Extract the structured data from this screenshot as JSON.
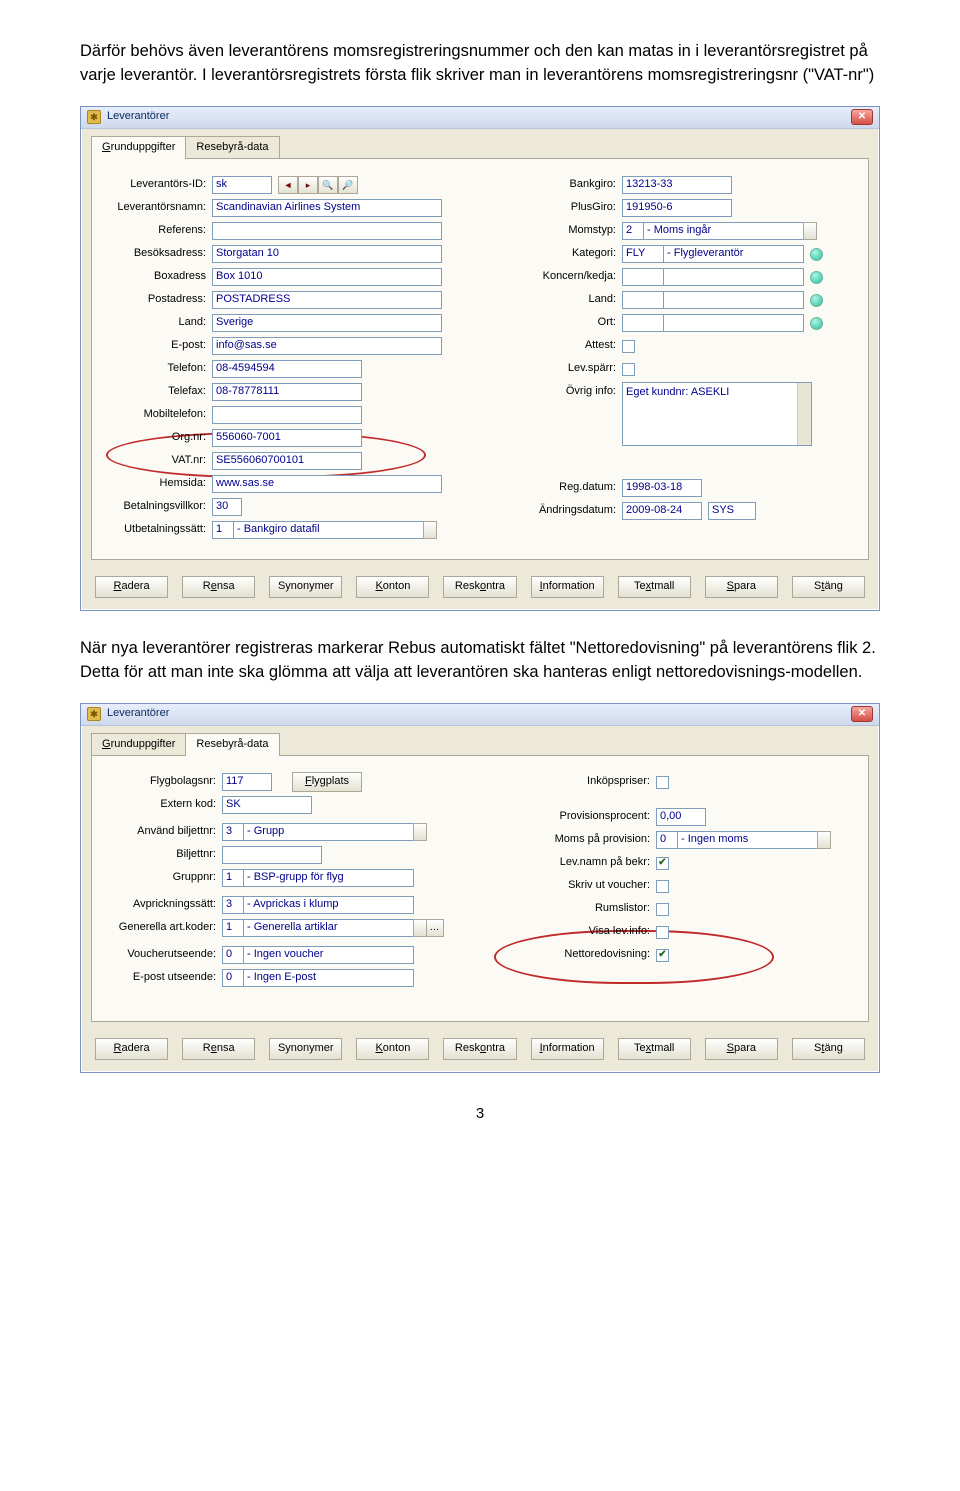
{
  "paragraph1": "Därför behövs även leverantörens momsregistreringsnummer och den kan matas in i leverantörsregistret på varje leverantör. I leverantörsregistrets första flik skriver man in leverantörens momsregistreringsnr (\"VAT-nr\")",
  "paragraph2": "När nya leverantörer registreras markerar Rebus automatiskt fältet \"Nettoredovisning\" på leverantörens flik 2. Detta för att man inte ska glömma att välja att leverantören ska hanteras enligt nettoredovisnings-modellen.",
  "page_num": "3",
  "win1": {
    "title": "Leverantörer",
    "tabs": {
      "a": "Grunduppgifter",
      "b": "Resebyrå-data"
    },
    "left_labels": {
      "lev_id": "Leverantörs-ID:",
      "lev_namn": "Leverantörsnamn:",
      "ref": "Referens:",
      "besok": "Besöksadress:",
      "box": "Boxadress",
      "post": "Postadress:",
      "land": "Land:",
      "epost": "E-post:",
      "tel": "Telefon:",
      "fax": "Telefax:",
      "mobil": "Mobiltelefon:",
      "org": "Org.nr:",
      "vat": "VAT.nr:",
      "hem": "Hemsida:",
      "betv": "Betalningsvillkor:",
      "utb": "Utbetalningssätt:"
    },
    "left_values": {
      "lev_id": "sk",
      "lev_namn": "Scandinavian Airlines System",
      "ref": "",
      "besok": "Storgatan 10",
      "box": "Box 1010",
      "post": "POSTADRESS",
      "land": "Sverige",
      "epost": "info@sas.se",
      "tel": "08-4594594",
      "fax": "08-78778111",
      "mobil": "",
      "org": "556060-7001",
      "vat": "SE556060700101",
      "hem": "www.sas.se",
      "betv": "30",
      "utb_code": "1",
      "utb_text": "- Bankgiro datafil"
    },
    "right_labels": {
      "bank": "Bankgiro:",
      "plus": "PlusGiro:",
      "momstyp": "Momstyp:",
      "kategori": "Kategori:",
      "koncern": "Koncern/kedja:",
      "land": "Land:",
      "ort": "Ort:",
      "attest": "Attest:",
      "spärr": "Lev.spärr:",
      "info": "Övrig info:",
      "reg": "Reg.datum:",
      "andr": "Ändringsdatum:"
    },
    "right_values": {
      "bank": "13213-33",
      "plus": "191950-6",
      "momstyp_code": "2",
      "momstyp_text": "- Moms ingår",
      "kat_code": "FLY",
      "kat_text": "- Flygleverantör",
      "koncern": "",
      "land": "",
      "ort": "",
      "info": "Eget kundnr: ASEKLI",
      "reg": "1998-03-18",
      "andr": "2009-08-24",
      "andr_by": "SYS"
    },
    "buttons": {
      "radera": "Radera",
      "rensa": "Rensa",
      "synonymer": "Synonymer",
      "konton": "Konton",
      "reskontra": "Reskontra",
      "information": "Information",
      "textmall": "Textmall",
      "spara": "Spara",
      "stang": "Stäng"
    }
  },
  "win2": {
    "title": "Leverantörer",
    "tabs": {
      "a": "Grunduppgifter",
      "b": "Resebyrå-data"
    },
    "left_labels": {
      "flyg": "Flygbolagsnr:",
      "flygplats": "Flygplats",
      "ext": "Extern kod:",
      "anvbilj": "Använd biljettnr:",
      "bilj": "Biljettnr:",
      "grupp": "Gruppnr:",
      "avp": "Avprickningssätt:",
      "genart": "Generella art.koder:",
      "vou": "Voucherutseende:",
      "epostu": "E-post utseende:"
    },
    "left_values": {
      "flyg": "117",
      "ext": "SK",
      "anvbilj_code": "3",
      "anvbilj_text": "- Grupp",
      "bilj": "",
      "grupp_code": "1",
      "grupp_text": "- BSP-grupp för flyg",
      "avp_code": "3",
      "avp_text": "- Avprickas i klump",
      "genart_code": "1",
      "genart_text": "- Generella artiklar",
      "vou_code": "0",
      "vou_text": "- Ingen voucher",
      "epostu_code": "0",
      "epostu_text": "- Ingen E-post"
    },
    "right_labels": {
      "inkop": "Inköpspriser:",
      "prov": "Provisionsprocent:",
      "momsprov": "Moms på provision:",
      "levnamn": "Lev.namn på bekr:",
      "skriv": "Skriv ut voucher:",
      "rums": "Rumslistor:",
      "visa": "Visa lev.info:",
      "netto": "Nettoredovisning:"
    },
    "right_values": {
      "prov": "0,00",
      "momsprov_code": "0",
      "momsprov_text": "- Ingen moms"
    },
    "buttons": {
      "radera": "Radera",
      "rensa": "Rensa",
      "synonymer": "Synonymer",
      "konton": "Konton",
      "reskontra": "Reskontra",
      "information": "Information",
      "textmall": "Textmall",
      "spara": "Spara",
      "stang": "Stäng"
    }
  }
}
